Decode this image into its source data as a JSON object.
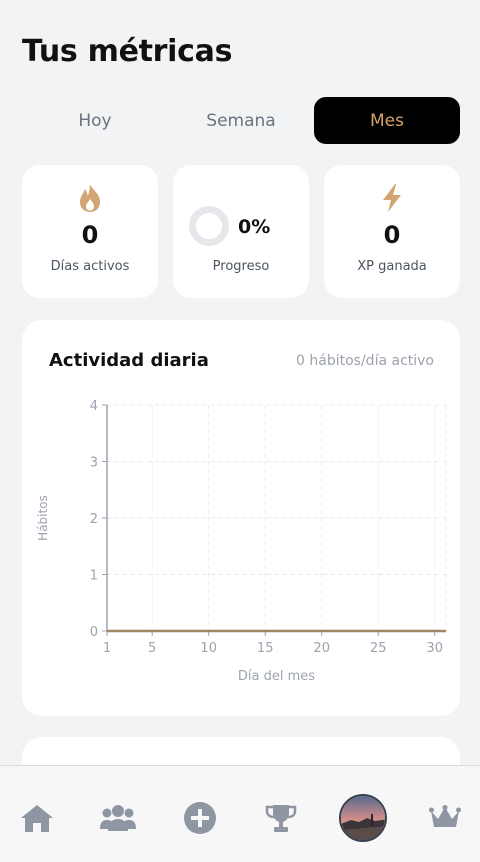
{
  "header": {
    "title": "Tus métricas"
  },
  "tabs": [
    {
      "label": "Hoy",
      "active": false
    },
    {
      "label": "Semana",
      "active": false
    },
    {
      "label": "Mes",
      "active": true
    }
  ],
  "stats": {
    "active_days": {
      "value": "0",
      "label": "Días activos",
      "icon": "flame-icon"
    },
    "progress": {
      "value": "0%",
      "label": "Progreso",
      "fraction": 0
    },
    "xp": {
      "value": "0",
      "label": "XP ganada",
      "icon": "lightning-icon"
    }
  },
  "chart_card": {
    "title": "Actividad diaria",
    "subtitle": "0 hábitos/día activo"
  },
  "chart_data": {
    "type": "line",
    "xlabel": "Día del mes",
    "ylabel": "Hábitos",
    "xlim": [
      1,
      31
    ],
    "ylim": [
      0,
      4
    ],
    "x_ticks": [
      1,
      5,
      10,
      15,
      20,
      25,
      30
    ],
    "y_ticks": [
      0,
      1,
      2,
      3,
      4
    ],
    "grid": true,
    "series": [
      {
        "x": [
          1,
          2,
          3,
          4,
          5,
          6,
          7,
          8,
          9,
          10,
          11,
          12,
          13,
          14,
          15,
          16,
          17,
          18,
          19,
          20,
          21,
          22,
          23,
          24,
          25,
          26,
          27,
          28,
          29,
          30,
          31
        ],
        "values": [
          0,
          0,
          0,
          0,
          0,
          0,
          0,
          0,
          0,
          0,
          0,
          0,
          0,
          0,
          0,
          0,
          0,
          0,
          0,
          0,
          0,
          0,
          0,
          0,
          0,
          0,
          0,
          0,
          0,
          0,
          0
        ]
      }
    ]
  },
  "colors": {
    "accent": "#d9a36a",
    "line": "#a08662",
    "icon_gold": "#d4a574",
    "nav_icon": "#8f96a3"
  },
  "nav": [
    {
      "icon": "home-icon"
    },
    {
      "icon": "group-icon"
    },
    {
      "icon": "add-icon"
    },
    {
      "icon": "trophy-icon"
    },
    {
      "icon": "avatar"
    },
    {
      "icon": "crown-icon"
    }
  ]
}
